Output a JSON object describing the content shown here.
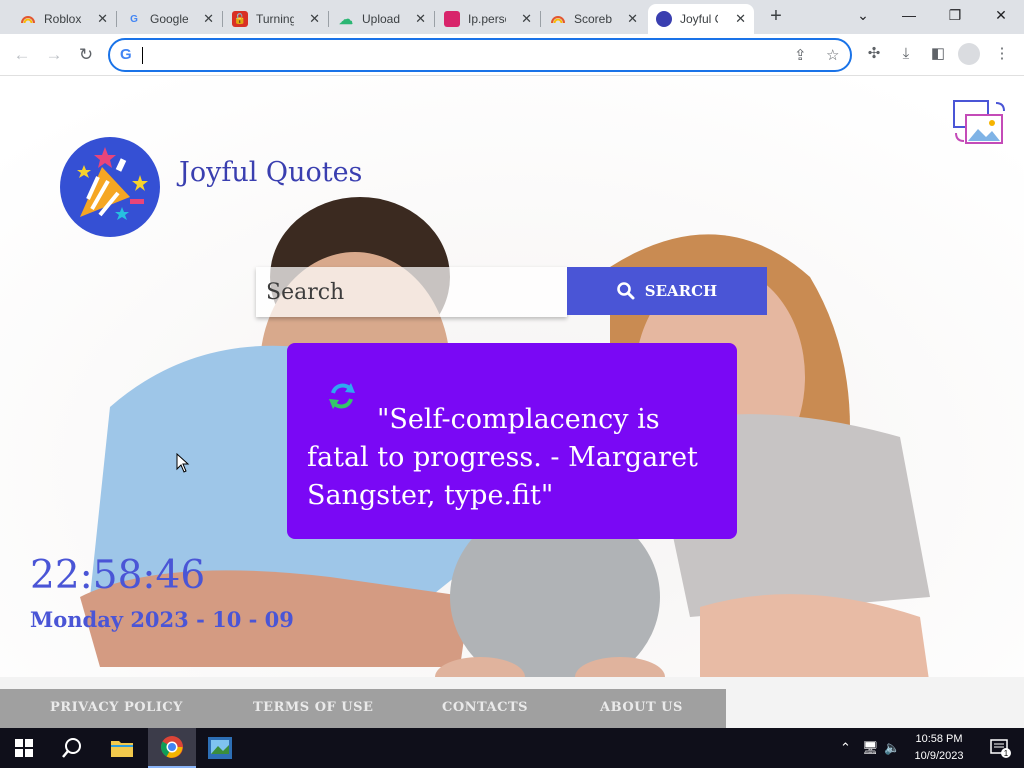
{
  "browser": {
    "tabs": [
      {
        "title": "Roblox I",
        "favicon_color": "#e3572f",
        "icon": "rainbow-icon"
      },
      {
        "title": "Google",
        "favicon_color": "#4285f4",
        "icon": "google-icon"
      },
      {
        "title": "Turning",
        "favicon_color": "#d93025",
        "icon": "lock-icon"
      },
      {
        "title": "Upload",
        "favicon_color": "#2bb673",
        "icon": "upload-icon"
      },
      {
        "title": "Ip.perso",
        "favicon_color": "#d8246b",
        "icon": "ip-icon"
      },
      {
        "title": "Scorebo",
        "favicon_color": "#e3572f",
        "icon": "rainbow-icon"
      },
      {
        "title": "Joyful C",
        "favicon_color": "#3a3fb0",
        "icon": "party-icon"
      }
    ],
    "active_tab_index": 6,
    "new_tab": "+",
    "window": {
      "collapse": "⌄",
      "minimize": "—",
      "restore": "❐",
      "close": "✕"
    },
    "address": {
      "value": "",
      "placeholder": ""
    }
  },
  "site": {
    "title": "Joyful Quotes",
    "search": {
      "placeholder": "Search",
      "button_label": "SEARCH"
    },
    "quote": "\"Self-complacency is fatal to progress. - Margaret Sangster, type.fit\"",
    "clock": "22:58:46",
    "date": "Monday 2023 - 10 - 09",
    "footer": {
      "links": [
        "PRIVACY POLICY",
        "TERMS OF USE",
        "CONTACTS",
        "ABOUT US"
      ]
    },
    "colors": {
      "accent": "#4a55d6",
      "quote_bg": "#7a08f5",
      "title": "#3a3fb0"
    }
  },
  "taskbar": {
    "time": "10:58 PM",
    "date": "10/9/2023",
    "notification_count": "1"
  }
}
